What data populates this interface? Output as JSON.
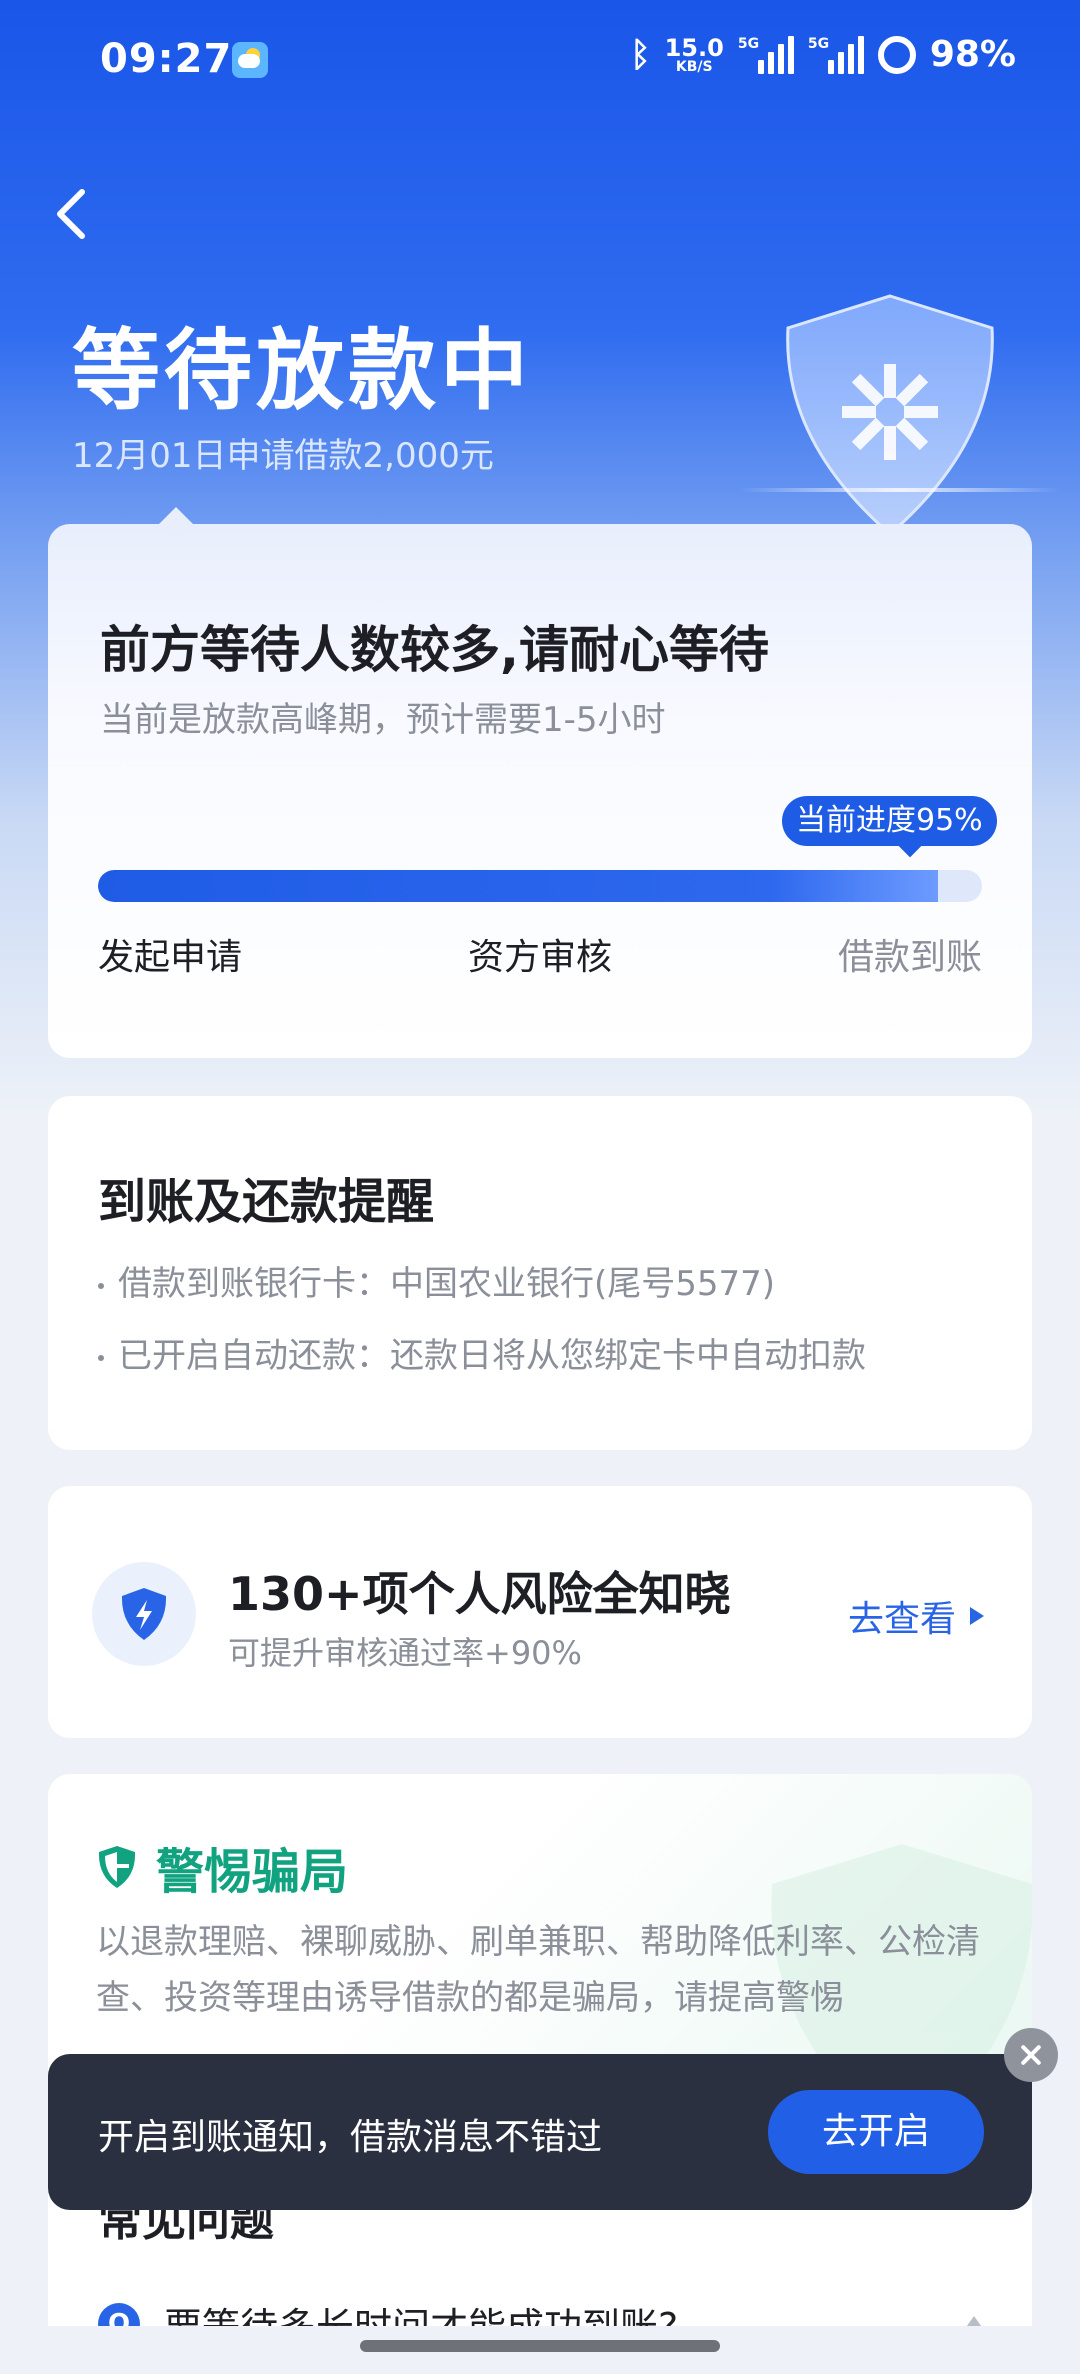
{
  "status_bar": {
    "time": "09:27",
    "net_speed_value": "15.0",
    "net_speed_unit": "KB/S",
    "signal1_tag": "5G",
    "signal2_tag": "5G",
    "battery": "98%"
  },
  "header": {
    "title": "等待放款中",
    "subtitle": "12月01日申请借款2,000元"
  },
  "progress_card": {
    "title": "前方等待人数较多,请耐心等待",
    "subtitle": "当前是放款高峰期，预计需要1-5小时",
    "progress_label": "当前进度95%",
    "progress_value": 95,
    "steps": [
      "发起申请",
      "资方审核",
      "借款到账"
    ]
  },
  "reminder": {
    "title": "到账及还款提醒",
    "line1": "借款到账银行卡：中国农业银行(尾号5577)",
    "line2": "已开启自动还款：还款日将从您绑定卡中自动扣款"
  },
  "risk": {
    "title": "130+项个人风险全知晓",
    "subtitle": "可提升审核通过率+90%",
    "link": "去查看"
  },
  "fraud": {
    "title": "警惕骗局",
    "text": "以退款理赔、裸聊威胁、刷单兼职、帮助降低利率、公检清查、投资等理由诱导借款的都是骗局，请提高警惕"
  },
  "faq": {
    "title": "常见问题",
    "q_badge": "Q",
    "question1": "要等待多长时间才能成功到账?"
  },
  "toast": {
    "text": "开启到账通知，借款消息不错过",
    "button": "去开启"
  },
  "colors": {
    "brand_blue": "#1f5ce6",
    "fraud_green": "#11a37f"
  }
}
